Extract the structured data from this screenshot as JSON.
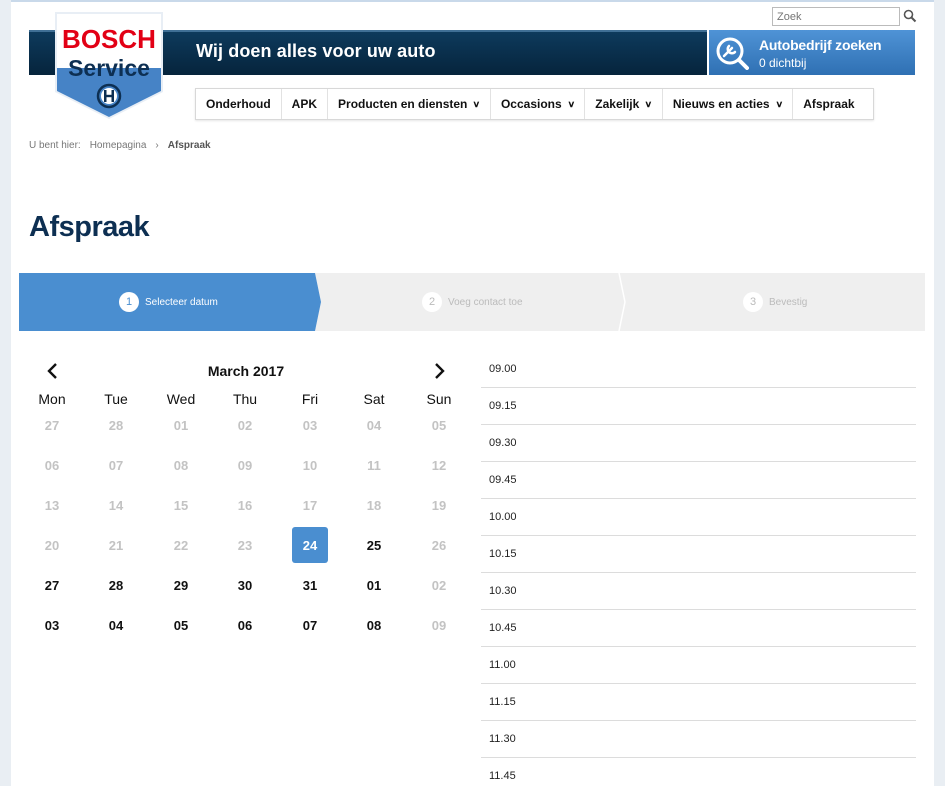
{
  "search": {
    "placeholder": "Zoek"
  },
  "header": {
    "tagline": "Wij doen alles voor uw auto",
    "logo_top": "BOSCH",
    "logo_bottom": "Service",
    "dealer_title": "Autobedrijf zoeken",
    "dealer_sub": "0 dichtbij"
  },
  "nav": {
    "items": [
      {
        "label": "Onderhoud",
        "dropdown": false
      },
      {
        "label": "APK",
        "dropdown": false
      },
      {
        "label": "Producten en diensten",
        "dropdown": true
      },
      {
        "label": "Occasions",
        "dropdown": true
      },
      {
        "label": "Zakelijk",
        "dropdown": true
      },
      {
        "label": "Nieuws en acties",
        "dropdown": true
      },
      {
        "label": "Afspraak",
        "dropdown": false
      }
    ]
  },
  "breadcrumb": {
    "prefix": "U bent hier:",
    "home": "Homepagina",
    "current": "Afspraak"
  },
  "page": {
    "title": "Afspraak"
  },
  "steps": [
    {
      "num": "1",
      "label": "Selecteer datum",
      "active": true
    },
    {
      "num": "2",
      "label": "Voeg contact toe",
      "active": false
    },
    {
      "num": "3",
      "label": "Bevestig",
      "active": false
    }
  ],
  "calendar": {
    "month": "March 2017",
    "weekdays": [
      "Mon",
      "Tue",
      "Wed",
      "Thu",
      "Fri",
      "Sat",
      "Sun"
    ],
    "weeks": [
      [
        [
          "27",
          "muted"
        ],
        [
          "28",
          "muted"
        ],
        [
          "01",
          "muted"
        ],
        [
          "02",
          "muted"
        ],
        [
          "03",
          "muted"
        ],
        [
          "04",
          "muted"
        ],
        [
          "05",
          "muted"
        ]
      ],
      [
        [
          "06",
          "muted"
        ],
        [
          "07",
          "muted"
        ],
        [
          "08",
          "muted"
        ],
        [
          "09",
          "muted"
        ],
        [
          "10",
          "muted"
        ],
        [
          "11",
          "muted"
        ],
        [
          "12",
          "muted"
        ]
      ],
      [
        [
          "13",
          "muted"
        ],
        [
          "14",
          "muted"
        ],
        [
          "15",
          "muted"
        ],
        [
          "16",
          "muted"
        ],
        [
          "17",
          "muted"
        ],
        [
          "18",
          "muted"
        ],
        [
          "19",
          "muted"
        ]
      ],
      [
        [
          "20",
          "muted"
        ],
        [
          "21",
          "muted"
        ],
        [
          "22",
          "muted"
        ],
        [
          "23",
          "muted"
        ],
        [
          "24",
          "selected"
        ],
        [
          "25",
          "active"
        ],
        [
          "26",
          "muted"
        ]
      ],
      [
        [
          "27",
          "active"
        ],
        [
          "28",
          "active"
        ],
        [
          "29",
          "active"
        ],
        [
          "30",
          "active"
        ],
        [
          "31",
          "active"
        ],
        [
          "01",
          "active"
        ],
        [
          "02",
          "muted"
        ]
      ],
      [
        [
          "03",
          "active"
        ],
        [
          "04",
          "active"
        ],
        [
          "05",
          "active"
        ],
        [
          "06",
          "active"
        ],
        [
          "07",
          "active"
        ],
        [
          "08",
          "active"
        ],
        [
          "09",
          "muted"
        ]
      ]
    ]
  },
  "timeslots": [
    "09.00",
    "09.15",
    "09.30",
    "09.45",
    "10.00",
    "10.15",
    "10.30",
    "10.45",
    "11.00",
    "11.15",
    "11.30",
    "11.45"
  ],
  "colors": {
    "brand_blue": "#4a8ed0",
    "navy": "#0d2f52",
    "bosch_red": "#e20015"
  }
}
